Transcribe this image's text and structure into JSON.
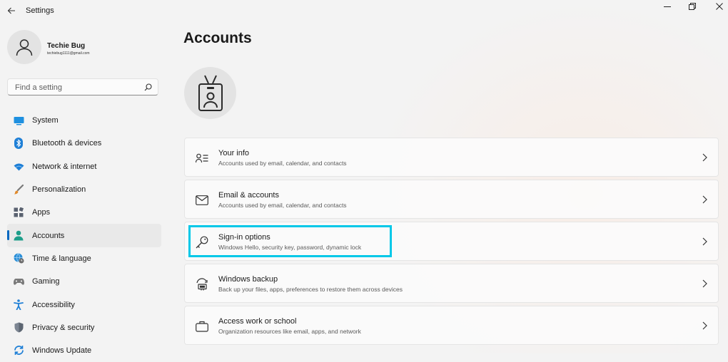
{
  "window": {
    "title": "Settings"
  },
  "profile": {
    "name": "Techie Bug",
    "email": "techiebug1111@gmail.com"
  },
  "search": {
    "placeholder": "Find a setting"
  },
  "sidebar": {
    "items": [
      {
        "label": "System",
        "icon": "monitor-icon",
        "active": false
      },
      {
        "label": "Bluetooth & devices",
        "icon": "bluetooth-icon",
        "active": false
      },
      {
        "label": "Network & internet",
        "icon": "wifi-icon",
        "active": false
      },
      {
        "label": "Personalization",
        "icon": "paintbrush-icon",
        "active": false
      },
      {
        "label": "Apps",
        "icon": "apps-grid-icon",
        "active": false
      },
      {
        "label": "Accounts",
        "icon": "person-icon",
        "active": true
      },
      {
        "label": "Time & language",
        "icon": "globe-clock-icon",
        "active": false
      },
      {
        "label": "Gaming",
        "icon": "gamepad-icon",
        "active": false
      },
      {
        "label": "Accessibility",
        "icon": "accessibility-icon",
        "active": false
      },
      {
        "label": "Privacy & security",
        "icon": "shield-icon",
        "active": false
      },
      {
        "label": "Windows Update",
        "icon": "update-icon",
        "active": false
      }
    ]
  },
  "main": {
    "title": "Accounts",
    "cards": [
      {
        "title": "Your info",
        "subtitle": "Accounts used by email, calendar, and contacts",
        "icon": "person-list-icon"
      },
      {
        "title": "Email & accounts",
        "subtitle": "Accounts used by email, calendar, and contacts",
        "icon": "mail-icon"
      },
      {
        "title": "Sign-in options",
        "subtitle": "Windows Hello, security key, password, dynamic lock",
        "icon": "key-icon",
        "highlighted": true
      },
      {
        "title": "Windows backup",
        "subtitle": "Back up your files, apps, preferences to restore them across devices",
        "icon": "backup-sync-icon"
      },
      {
        "title": "Access work or school",
        "subtitle": "Organization resources like email, apps, and network",
        "icon": "briefcase-icon"
      }
    ]
  },
  "colors": {
    "accent": "#0067c0",
    "highlight": "#00c8e8",
    "background": "#f3f3f3"
  }
}
